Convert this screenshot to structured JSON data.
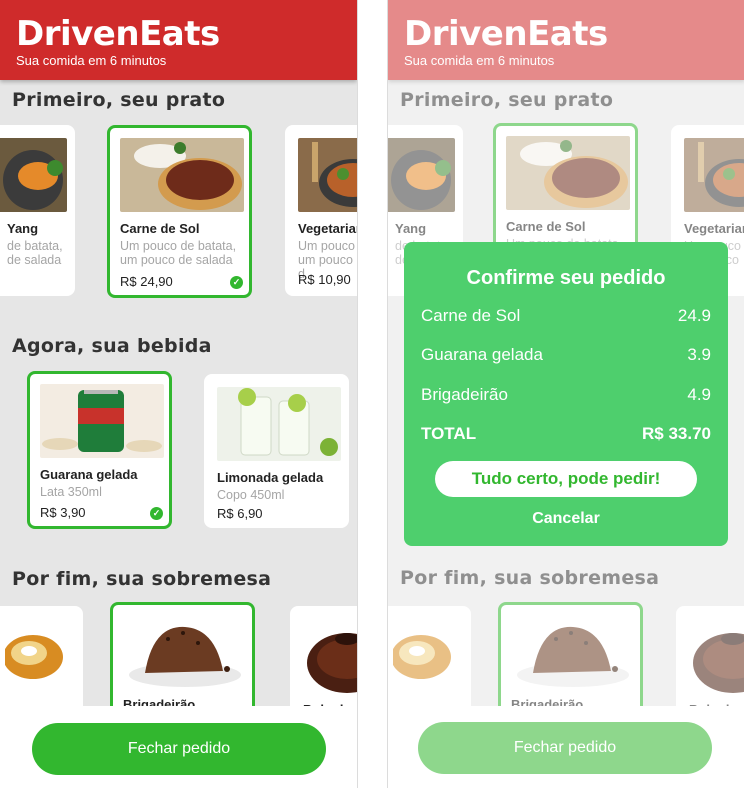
{
  "app": {
    "brand": "DrivenEats",
    "tagline": "Sua comida em 6 minutos"
  },
  "colors": {
    "header": "#cf2b2b",
    "selected": "#32b72f",
    "modal": "#4ecf6d"
  },
  "sections": {
    "dishes": {
      "title": "Primeiro, seu prato",
      "items": [
        {
          "name": "Yang",
          "desc": "de batata, de salada",
          "price": ""
        },
        {
          "name": "Carne de Sol",
          "desc": "Um pouco de batata, um pouco de salada",
          "price": "R$ 24,90"
        },
        {
          "name": "Vegetarian",
          "desc": "Um pouco um pouco d",
          "price": "R$ 10,90"
        }
      ]
    },
    "drinks": {
      "title": "Agora, sua bebida",
      "items": [
        {
          "name": "Guarana gelada",
          "desc": "Lata 350ml",
          "price": "R$ 3,90"
        },
        {
          "name": "Limonada gelada",
          "desc": "Copo 450ml",
          "price": "R$ 6,90"
        }
      ]
    },
    "desserts": {
      "title": "Por fim, sua sobremesa",
      "items": [
        {
          "name": "",
          "desc": "",
          "price": ""
        },
        {
          "name": "Brigadeirão",
          "desc": "",
          "price": ""
        },
        {
          "name": "Bolo de c",
          "desc": "",
          "price": ""
        }
      ]
    }
  },
  "footer": {
    "button": "Fechar pedido"
  },
  "modal": {
    "title": "Confirme seu pedido",
    "rows": [
      {
        "name": "Carne de Sol",
        "value": "24.9"
      },
      {
        "name": "Guarana gelada",
        "value": "3.9"
      },
      {
        "name": "Brigadeirão",
        "value": "4.9"
      }
    ],
    "total_label": "TOTAL",
    "total_value": "R$ 33.70",
    "confirm": "Tudo certo, pode pedir!",
    "cancel": "Cancelar"
  }
}
